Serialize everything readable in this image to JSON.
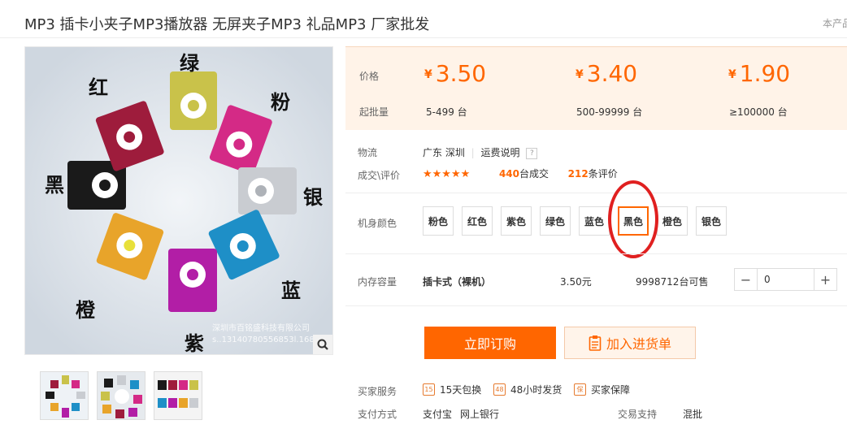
{
  "header": {
    "title": "MP3 插卡小夹子MP3播放器 无屏夹子MP3 礼品MP3 厂家批发",
    "right_link": "本产品"
  },
  "gallery": {
    "watermark_line1": "深圳市百铭盛科技有限公司",
    "watermark_line2": "s..13140780556853l.1688.com",
    "color_labels": [
      "绿",
      "粉",
      "银",
      "蓝",
      "紫",
      "橙",
      "黑",
      "红"
    ],
    "thumbnails": [
      "thumb-1",
      "thumb-2",
      "thumb-3"
    ]
  },
  "price": {
    "price_label": "价格",
    "qty_label": "起批量",
    "currency": "¥",
    "tiers": [
      {
        "price": "3.50",
        "qty": "5-499 台"
      },
      {
        "price": "3.40",
        "qty": "500-99999 台"
      },
      {
        "price": "1.90",
        "qty": "≥100000 台"
      }
    ]
  },
  "logistics": {
    "label": "物流",
    "location": "广东 深圳",
    "shipping_note": "运费说明",
    "help": "?"
  },
  "deals": {
    "label": "成交\\评价",
    "stars": "★★★★★",
    "count": "440",
    "count_suffix": "台成交",
    "reviews": "212",
    "reviews_suffix": "条评价"
  },
  "colors": {
    "label": "机身颜色",
    "options": [
      "粉色",
      "红色",
      "紫色",
      "绿色",
      "蓝色",
      "黑色",
      "橙色",
      "银色"
    ],
    "selected": "黑色"
  },
  "capacity": {
    "label": "内存容量",
    "option": "插卡式（裸机）",
    "price": "3.50元",
    "stock": "9998712台可售",
    "quantity": "0",
    "minus": "−",
    "plus": "+"
  },
  "actions": {
    "order": "立即订购",
    "add_cart": "加入进货单"
  },
  "services": {
    "label": "买家服务",
    "items": [
      {
        "icon": "15",
        "text": "15天包换"
      },
      {
        "icon": "48",
        "text": "48小时发货"
      },
      {
        "icon": "保",
        "text": "买家保障"
      }
    ]
  },
  "payment": {
    "label": "支付方式",
    "methods": [
      "支付宝",
      "网上银行"
    ],
    "trade_label": "交易支持",
    "trade_value": "混批"
  },
  "colors_hex": {
    "accent": "#ff6600",
    "annotation": "#e02020"
  }
}
